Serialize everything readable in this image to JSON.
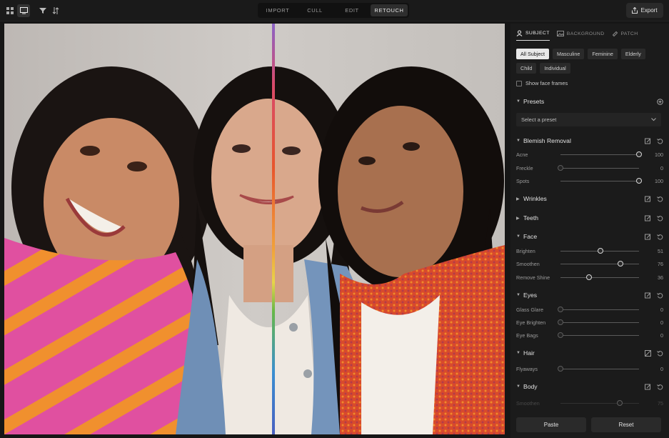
{
  "mode_tabs": [
    "IMPORT",
    "CULL",
    "EDIT",
    "RETOUCH"
  ],
  "active_mode": "RETOUCH",
  "export_label": "Export",
  "panel_tabs": [
    "SUBJECT",
    "BACKGROUND",
    "PATCH"
  ],
  "subject_chips": [
    "All Subject",
    "Masculine",
    "Feminine",
    "Elderly",
    "Child",
    "Individual"
  ],
  "show_face_frames": "Show face frames",
  "presets": {
    "title": "Presets",
    "placeholder": "Select a preset"
  },
  "blemish": {
    "title": "Blemish Removal",
    "sliders": [
      {
        "label": "Acne",
        "value": 100
      },
      {
        "label": "Freckle",
        "value": 0
      },
      {
        "label": "Spots",
        "value": 100
      }
    ]
  },
  "wrinkles": {
    "title": "Wrinkles"
  },
  "teeth": {
    "title": "Teeth"
  },
  "face": {
    "title": "Face",
    "sliders": [
      {
        "label": "Brighten",
        "value": 51
      },
      {
        "label": "Smoothen",
        "value": 76
      },
      {
        "label": "Remove Shine",
        "value": 36
      }
    ]
  },
  "eyes": {
    "title": "Eyes",
    "sliders": [
      {
        "label": "Glass Glare",
        "value": 0
      },
      {
        "label": "Eye Brighten",
        "value": 0
      },
      {
        "label": "Eye Bags",
        "value": 0
      }
    ]
  },
  "hair": {
    "title": "Hair",
    "sliders": [
      {
        "label": "Flyaways",
        "value": 0
      }
    ]
  },
  "body": {
    "title": "Body",
    "sliders": [
      {
        "label": "Smoothen",
        "value": 75
      }
    ]
  },
  "paste_label": "Paste",
  "reset_label": "Reset"
}
